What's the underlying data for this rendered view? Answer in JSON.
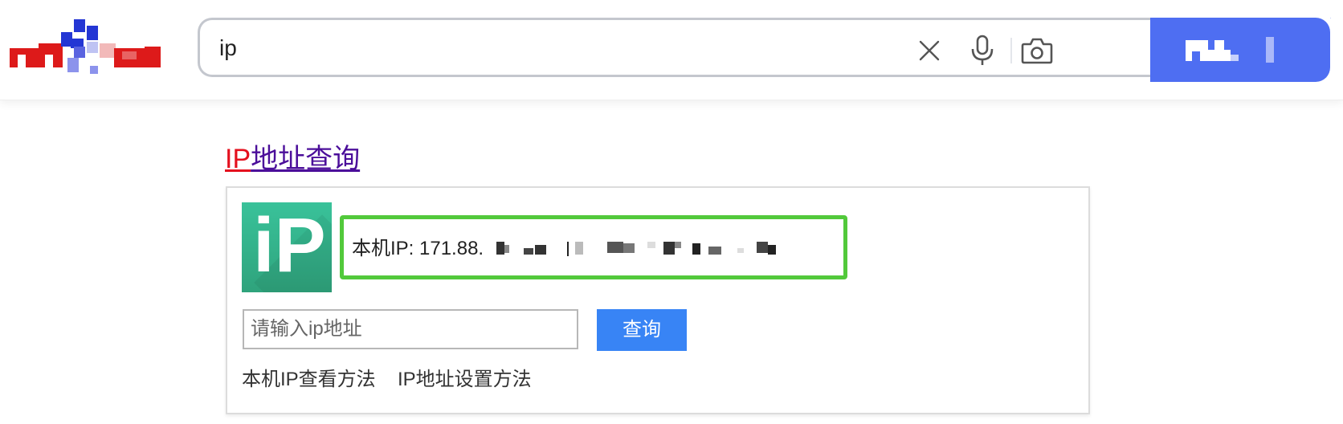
{
  "header": {
    "search": {
      "query": "ip"
    },
    "icons": {
      "clear": "close-icon",
      "voice": "microphone-icon",
      "image_search": "camera-icon"
    },
    "search_button_label": "百度一下"
  },
  "result": {
    "title_highlight": "IP",
    "title_rest": "地址查询",
    "card": {
      "logo_text": "iP",
      "local_ip_text": "本机IP: 171.88.",
      "input_placeholder": "请输入ip地址",
      "query_button": "查询",
      "links": [
        "本机IP查看方法",
        "IP地址设置方法"
      ]
    }
  },
  "colors": {
    "accent": "#4e6ef2",
    "title_visited": "#4b0e9a",
    "title_highlight": "#e4101e",
    "highlight_border": "#52c93b",
    "query_button": "#3884f5"
  }
}
